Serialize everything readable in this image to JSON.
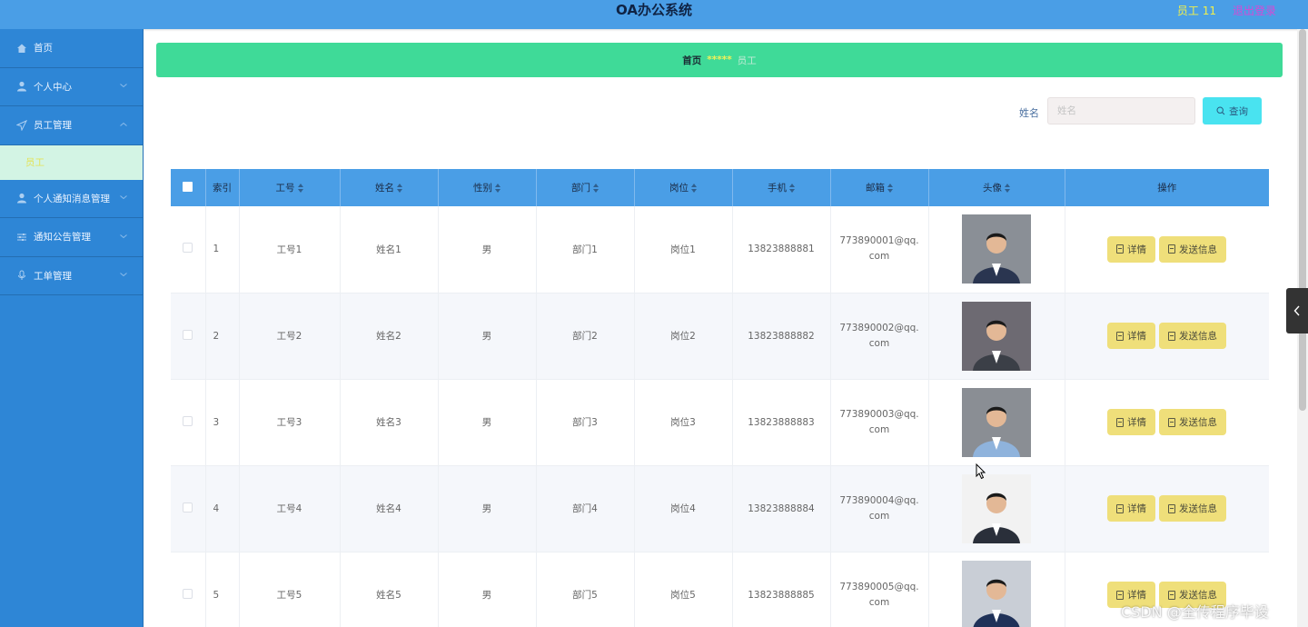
{
  "header": {
    "title": "OA办公系统",
    "user_label": "员工 11",
    "logout_label": "退出登录"
  },
  "sidebar": {
    "items": [
      {
        "label": "首页",
        "icon": "home-icon"
      },
      {
        "label": "个人中心",
        "icon": "user-icon"
      },
      {
        "label": "员工管理",
        "icon": "send-icon"
      },
      {
        "label": "个人通知消息管理",
        "icon": "user-icon"
      },
      {
        "label": "通知公告管理",
        "icon": "sliders-icon"
      },
      {
        "label": "工单管理",
        "icon": "mic-icon"
      }
    ],
    "active_sub": "员工"
  },
  "breadcrumb": {
    "home": "首页",
    "separator": "*****",
    "current": "员工"
  },
  "search": {
    "label": "姓名",
    "placeholder": "姓名",
    "button_label": "查询"
  },
  "table": {
    "columns": [
      "索引",
      "工号",
      "姓名",
      "性别",
      "部门",
      "岗位",
      "手机",
      "邮箱",
      "头像",
      "操作"
    ],
    "rows": [
      {
        "index": "1",
        "emp_no": "工号1",
        "name": "姓名1",
        "gender": "男",
        "dept": "部门1",
        "post": "岗位1",
        "phone": "13823888881",
        "email": "773890001@qq.com"
      },
      {
        "index": "2",
        "emp_no": "工号2",
        "name": "姓名2",
        "gender": "男",
        "dept": "部门2",
        "post": "岗位2",
        "phone": "13823888882",
        "email": "773890002@qq.com"
      },
      {
        "index": "3",
        "emp_no": "工号3",
        "name": "姓名3",
        "gender": "男",
        "dept": "部门3",
        "post": "岗位3",
        "phone": "13823888883",
        "email": "773890003@qq.com"
      },
      {
        "index": "4",
        "emp_no": "工号4",
        "name": "姓名4",
        "gender": "男",
        "dept": "部门4",
        "post": "岗位4",
        "phone": "13823888884",
        "email": "773890004@qq.com"
      },
      {
        "index": "5",
        "emp_no": "工号5",
        "name": "姓名5",
        "gender": "男",
        "dept": "部门5",
        "post": "岗位5",
        "phone": "13823888885",
        "email": "773890005@qq.com"
      }
    ],
    "detail_label": "详情",
    "send_label": "发送信息"
  },
  "watermark": "CSDN @全传程序毕设",
  "colors": {
    "header": "#4a9ee6",
    "sidebar": "#2e86d6",
    "banner": "#3fda98",
    "search_button": "#49e3f0",
    "action_button": "#efdf7a"
  }
}
